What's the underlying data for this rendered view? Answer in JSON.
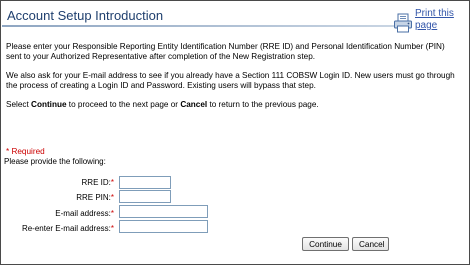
{
  "header": {
    "title": "Account Setup Introduction",
    "print_label": "Print this page"
  },
  "content": {
    "para1": "Please enter your Responsible Reporting Entity Identification Number (RRE ID) and Personal Identification Number (PIN) sent to your Authorized Representative after completion of the New Registration step.",
    "para2": "We also ask for your E-mail address to see if you already have a Section 111 COBSW Login ID. New users must go through the process of creating a Login ID and Password. Existing users will bypass that step.",
    "para3_prefix": "Select ",
    "para3_continue": "Continue",
    "para3_mid": " to proceed to the next page or ",
    "para3_cancel": "Cancel",
    "para3_suffix": " to return to the previous page."
  },
  "form": {
    "required_note": "* Required",
    "provide_text": "Please provide the following:",
    "required_marker": "*",
    "fields": [
      {
        "label": "RRE ID:",
        "value": ""
      },
      {
        "label": "RRE PIN:",
        "value": ""
      },
      {
        "label": "E-mail address:",
        "value": ""
      },
      {
        "label": "Re-enter E-mail address:",
        "value": ""
      }
    ]
  },
  "actions": {
    "continue_label": "Continue",
    "cancel_label": "Cancel"
  },
  "colors": {
    "title": "#1f3f6e",
    "link": "#3356a9",
    "required": "#cc0000"
  },
  "icons": {
    "print": "printer-icon"
  }
}
